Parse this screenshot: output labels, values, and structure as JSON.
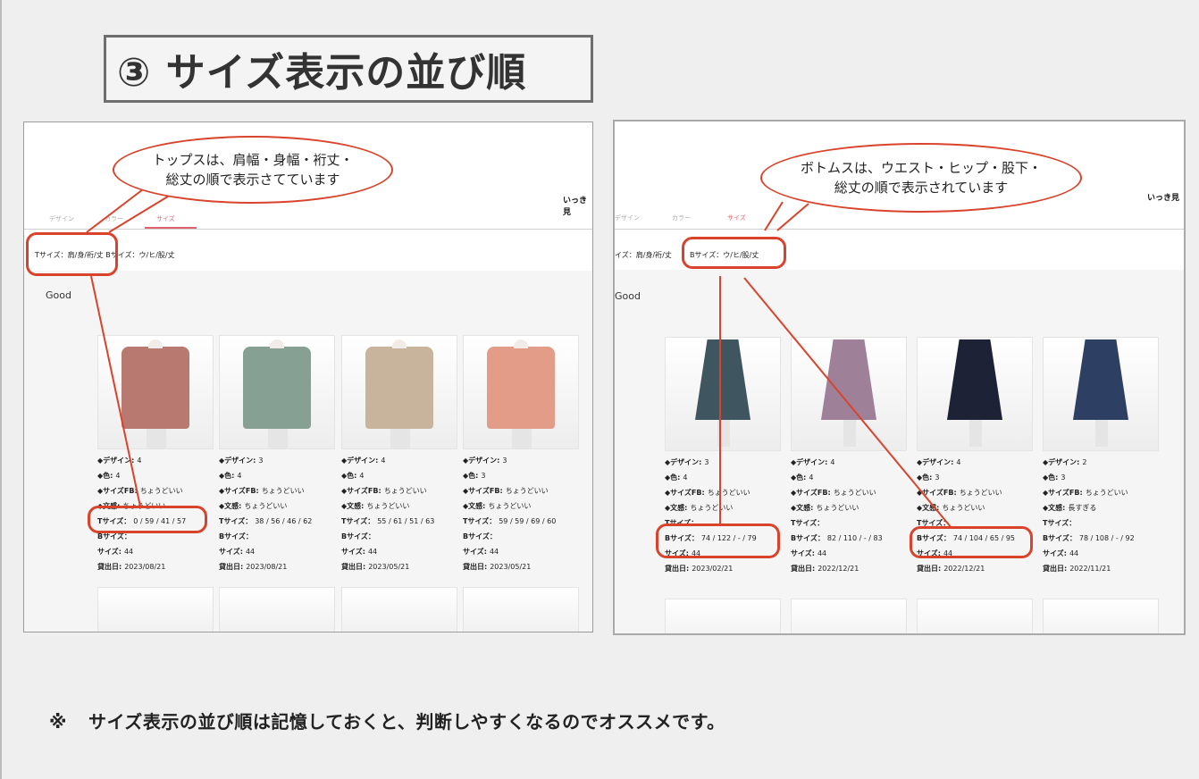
{
  "title": "③ サイズ表示の並び順",
  "footnote": {
    "mark": "※",
    "text": "サイズ表示の並び順は記憶しておくと、判断しやすくなるのでオススメです。"
  },
  "accent_color": "#d9432b",
  "left_panel": {
    "header_link": "いっき見",
    "tabs": [
      "デザイン",
      "カラー",
      "サイズ"
    ],
    "sizes_line": "Tサイズ：肩/身/裄/丈 Bサイズ：ウ/ヒ/股/丈",
    "section": "Good",
    "bubble": {
      "line1": "トップスは、肩幅・身幅・裄丈・",
      "line2": "総丈の順で表示さてています"
    },
    "cards": [
      {
        "design": "4",
        "color": "4",
        "sizefb": "ちょうどいい",
        "texture": "ちょうどいい",
        "tsize": "0 / 59 / 41 / 57",
        "bsize": "",
        "size": "44",
        "date": "2023/08/21",
        "garment": "#b87a70"
      },
      {
        "design": "3",
        "color": "4",
        "sizefb": "ちょうどいい",
        "texture": "ちょうどいい",
        "tsize": "38 / 56 / 46 / 62",
        "bsize": "",
        "size": "44",
        "date": "2023/08/21",
        "garment": "#86a193"
      },
      {
        "design": "4",
        "color": "4",
        "sizefb": "ちょうどいい",
        "texture": "ちょうどいい",
        "tsize": "55 / 61 / 51 / 63",
        "bsize": "",
        "size": "44",
        "date": "2023/05/21",
        "garment": "#c8b49c"
      },
      {
        "design": "3",
        "color": "3",
        "sizefb": "ちょうどいい",
        "texture": "ちょうどいい",
        "tsize": "59 / 59 / 69 / 60",
        "bsize": "",
        "size": "44",
        "date": "2023/05/21",
        "garment": "#e29c88"
      }
    ]
  },
  "right_panel": {
    "header_link": "いっき見",
    "tabs": [
      "デザイン",
      "カラー",
      "サイズ"
    ],
    "sizes_line_a": "イズ：肩/身/裄/丈",
    "sizes_line_b": "Bサイズ：ウ/ヒ/股/丈",
    "section": "Good",
    "bubble": {
      "line1": "ボトムスは、ウエスト・ヒップ・股下・",
      "line2": "総丈の順で表示されています"
    },
    "cards": [
      {
        "design": "3",
        "color": "4",
        "sizefb": "ちょうどいい",
        "texture": "ちょうどいい",
        "tsize": "",
        "bsize": "74 / 122 / - / 79",
        "size": "44",
        "date": "2023/02/21",
        "garment": "#3f5560"
      },
      {
        "design": "4",
        "color": "4",
        "sizefb": "ちょうどいい",
        "texture": "ちょうどいい",
        "tsize": "",
        "bsize": "82 / 110 / - / 83",
        "size": "44",
        "date": "2022/12/21",
        "garment": "#9e8098"
      },
      {
        "design": "4",
        "color": "3",
        "sizefb": "ちょうどいい",
        "texture": "ちょうどいい",
        "tsize": "",
        "bsize": "74 / 104 / 65 / 95",
        "size": "44",
        "date": "2022/12/21",
        "garment": "#1d2236"
      },
      {
        "design": "2",
        "color": "3",
        "sizefb": "ちょうどいい",
        "texture": "長すぎる",
        "tsize": "",
        "bsize": "78 / 108 / - / 92",
        "size": "44",
        "date": "2022/11/21",
        "garment": "#2d3f63"
      }
    ]
  },
  "labels": {
    "design": "◆デザイン:",
    "color": "◆色:",
    "sizefb": "◆サイズFB:",
    "texture": "◆文感:",
    "tsize": "Tサイズ：",
    "bsize": "Bサイズ：",
    "size": "サイズ:",
    "date": "貸出日:"
  }
}
